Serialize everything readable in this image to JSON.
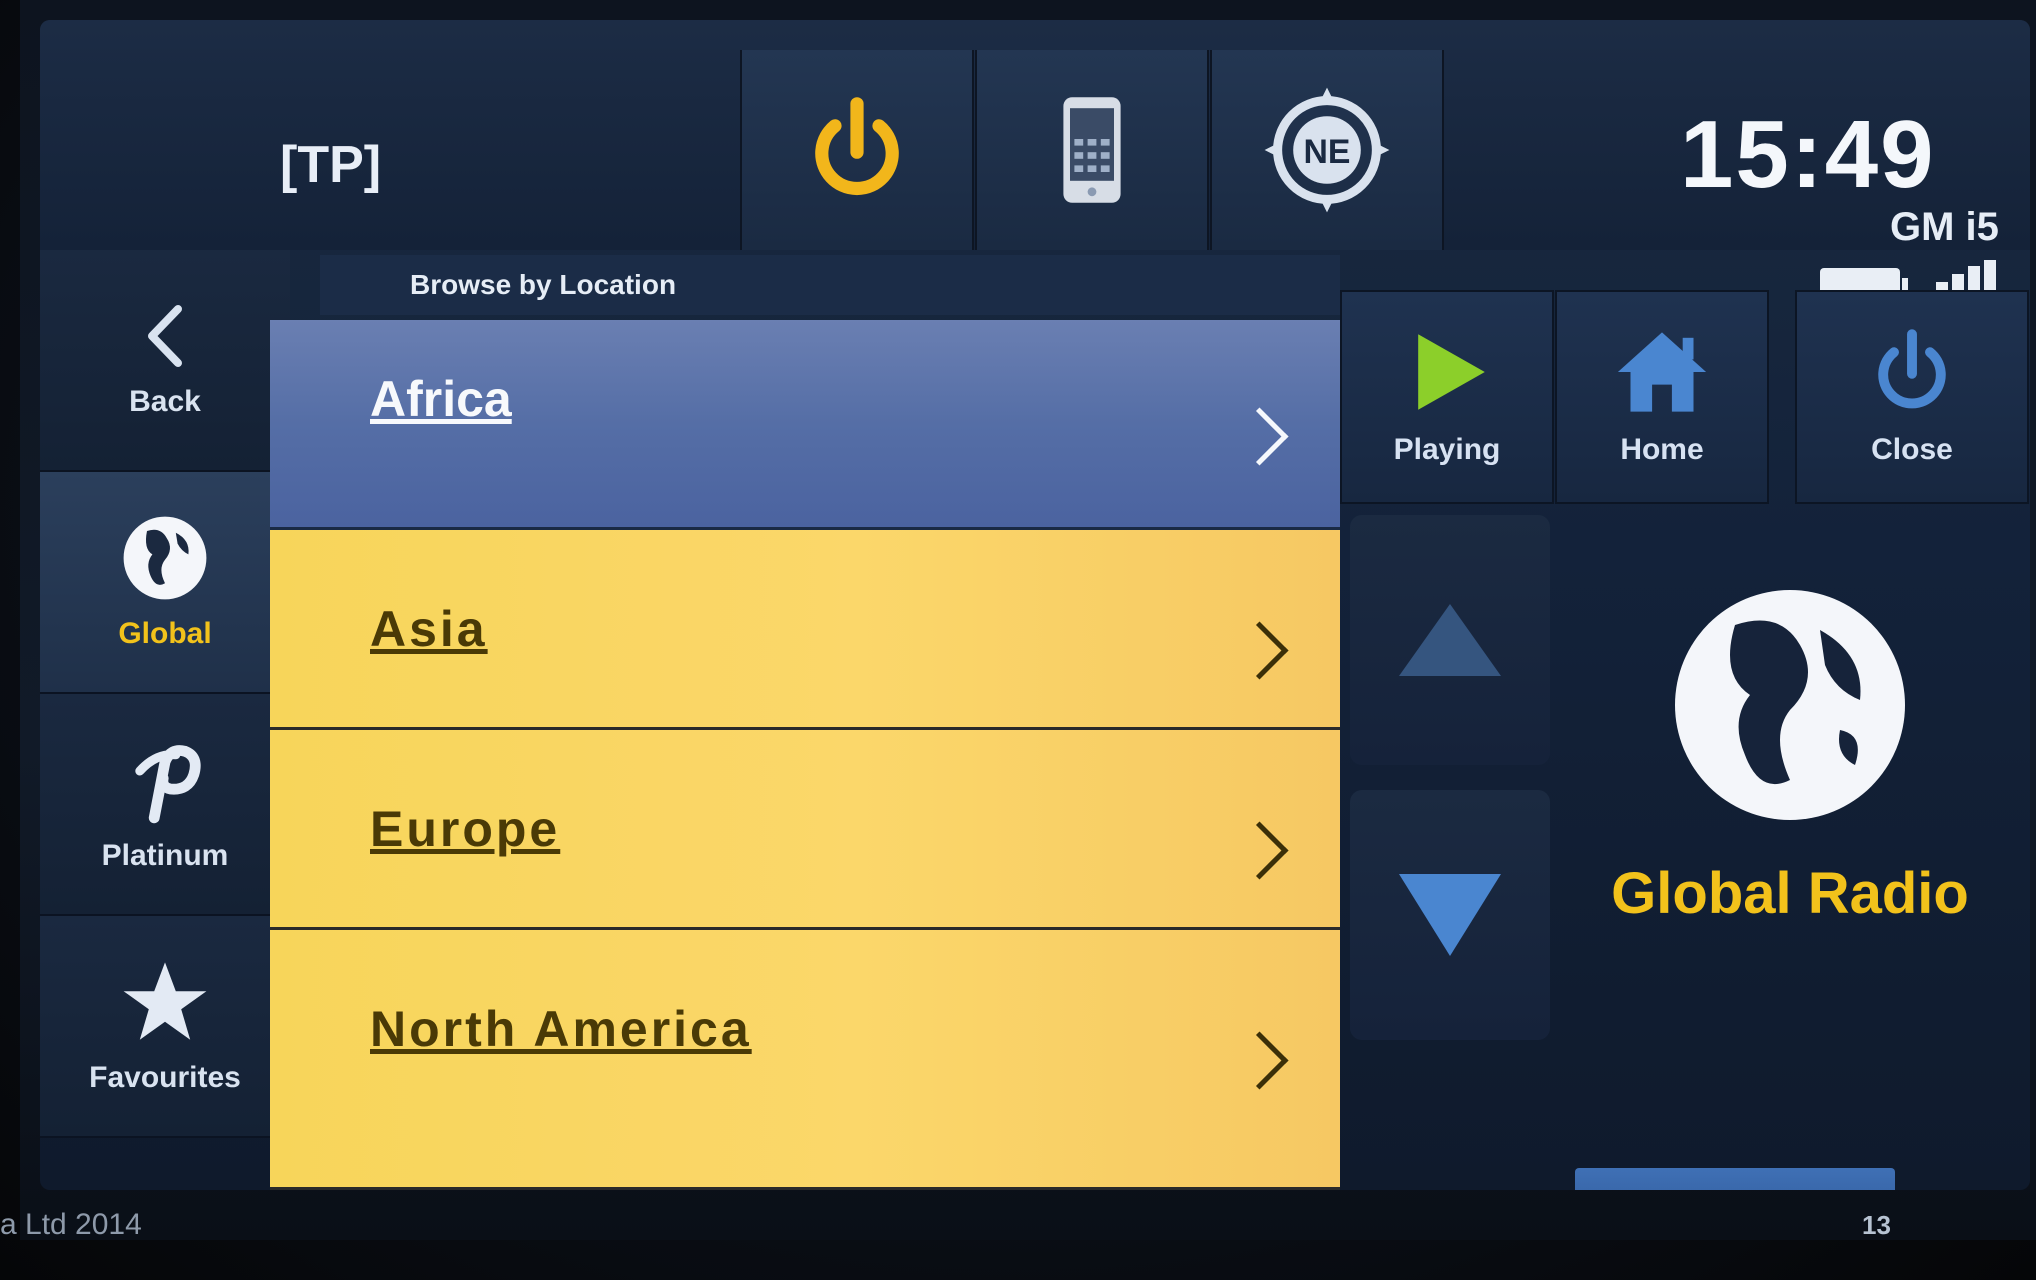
{
  "topbar": {
    "tp_label": "[TP]",
    "icons": [
      "power-icon",
      "phone-icon",
      "compass-icon"
    ],
    "compass_heading": "NE",
    "clock": "15:49",
    "network_label": "GM i5"
  },
  "sidebar": {
    "items": [
      {
        "label": "Back",
        "icon": "back-chevron-icon"
      },
      {
        "label": "Global",
        "icon": "globe-icon"
      },
      {
        "label": "Platinum",
        "icon": "platinum-p-icon"
      },
      {
        "label": "Favourites",
        "icon": "star-icon"
      }
    ]
  },
  "list": {
    "header": "Browse by Location",
    "items": [
      {
        "label": "Africa",
        "selected": true
      },
      {
        "label": "Asia",
        "selected": false
      },
      {
        "label": "Europe",
        "selected": false
      },
      {
        "label": "North America",
        "selected": false
      }
    ]
  },
  "controls": {
    "playing_label": "Playing",
    "home_label": "Home",
    "close_label": "Close"
  },
  "brand": {
    "name": "Global Radio"
  },
  "footer": {
    "left_text": "a Ltd 2014",
    "page_number": "13"
  },
  "colors": {
    "accent_yellow": "#f2c21b",
    "list_row": "#f8d45c",
    "selected_row": "#5a72aa",
    "play_green": "#8ccf2a",
    "control_blue": "#4a86d0"
  }
}
